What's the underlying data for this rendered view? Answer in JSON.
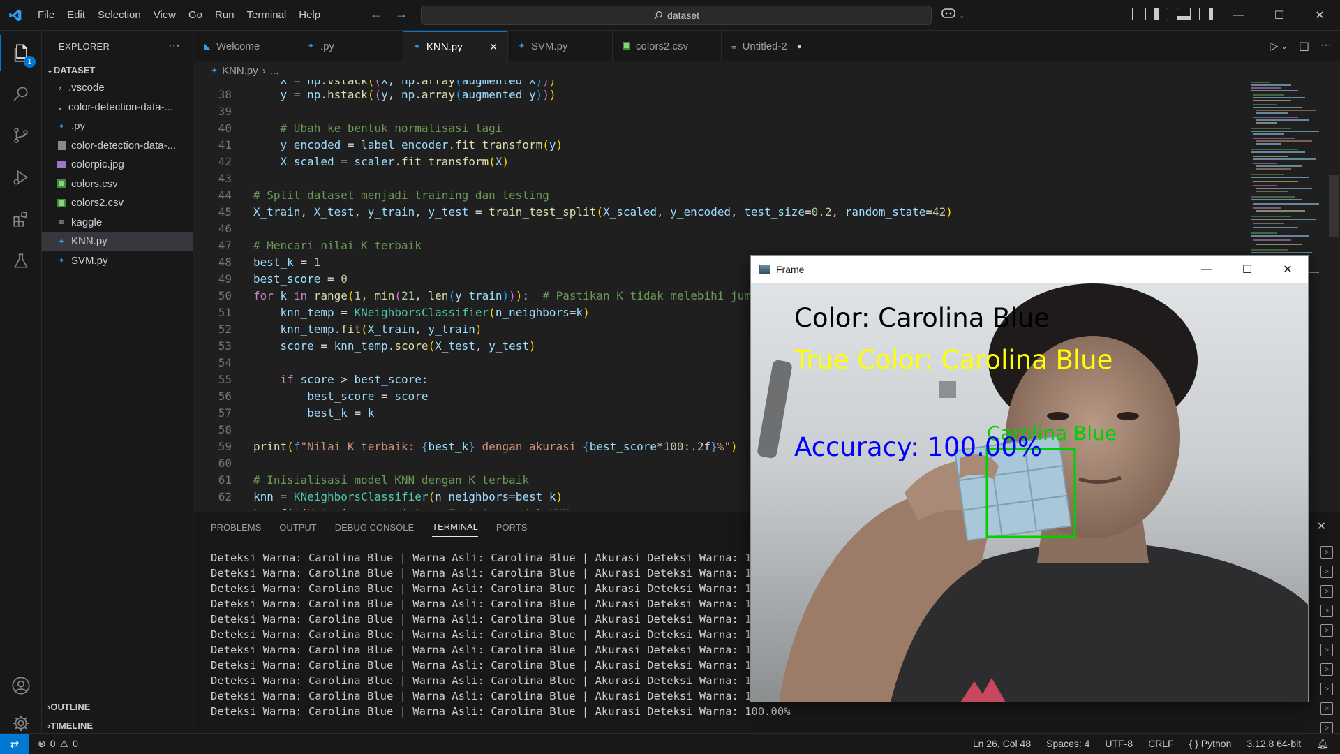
{
  "menu": [
    "File",
    "Edit",
    "Selection",
    "View",
    "Go",
    "Run",
    "Terminal",
    "Help"
  ],
  "search": {
    "value": "dataset"
  },
  "window_controls": {
    "minimize": "—",
    "maximize": "☐",
    "close": "✕"
  },
  "activity": {
    "explorer_badge": "1"
  },
  "sidebar": {
    "title": "EXPLORER",
    "more": "···",
    "folder": "DATASET",
    "items": [
      {
        "label": ".vscode",
        "type": "folder"
      },
      {
        "label": "color-detection-data-...",
        "type": "folder-open"
      },
      {
        "label": ".py",
        "type": "python"
      },
      {
        "label": "color-detection-data-...",
        "type": "file"
      },
      {
        "label": "colorpic.jpg",
        "type": "image"
      },
      {
        "label": "colors.csv",
        "type": "csv"
      },
      {
        "label": "colors2.csv",
        "type": "csv"
      },
      {
        "label": "kaggle",
        "type": "text"
      },
      {
        "label": "KNN.py",
        "type": "python",
        "selected": true
      },
      {
        "label": "SVM.py",
        "type": "python"
      }
    ],
    "outline": "OUTLINE",
    "timeline": "TIMELINE"
  },
  "tabs": [
    {
      "label": "Welcome",
      "icon": "vscode"
    },
    {
      "label": ".py",
      "icon": "python"
    },
    {
      "label": "KNN.py",
      "icon": "python",
      "active": true,
      "close": "✕"
    },
    {
      "label": "SVM.py",
      "icon": "python"
    },
    {
      "label": "colors2.csv",
      "icon": "csv"
    },
    {
      "label": "Untitled-2",
      "icon": "text",
      "dirty": "●"
    }
  ],
  "breadcrumb": {
    "file": "KNN.py",
    "rest": "..."
  },
  "editor": {
    "line_numbers": [
      "38",
      "39",
      "40",
      "41",
      "42",
      "43",
      "44",
      "45",
      "46",
      "47",
      "48",
      "49",
      "50",
      "51",
      "52",
      "53",
      "54",
      "55",
      "56",
      "57",
      "58",
      "59",
      "60",
      "61",
      "62"
    ]
  },
  "panel": {
    "tabs": [
      "PROBLEMS",
      "OUTPUT",
      "DEBUG CONSOLE",
      "TERMINAL",
      "PORTS"
    ],
    "active_tab": "TERMINAL",
    "terminal_lines": [
      "Deteksi Warna: Carolina Blue | Warna Asli: Carolina Blue | Akurasi Deteksi Warna: 100.",
      "Deteksi Warna: Carolina Blue | Warna Asli: Carolina Blue | Akurasi Deteksi Warna: 100.",
      "Deteksi Warna: Carolina Blue | Warna Asli: Carolina Blue | Akurasi Deteksi Warna: 100.",
      "Deteksi Warna: Carolina Blue | Warna Asli: Carolina Blue | Akurasi Deteksi Warna: 100.",
      "Deteksi Warna: Carolina Blue | Warna Asli: Carolina Blue | Akurasi Deteksi Warna: 100.",
      "Deteksi Warna: Carolina Blue | Warna Asli: Carolina Blue | Akurasi Deteksi Warna: 100.",
      "Deteksi Warna: Carolina Blue | Warna Asli: Carolina Blue | Akurasi Deteksi Warna: 100.",
      "Deteksi Warna: Carolina Blue | Warna Asli: Carolina Blue | Akurasi Deteksi Warna: 100.",
      "Deteksi Warna: Carolina Blue | Warna Asli: Carolina Blue | Akurasi Deteksi Warna: 100.",
      "Deteksi Warna: Carolina Blue | Warna Asli: Carolina Blue | Akurasi Deteksi Warna: 100.",
      "Deteksi Warna: Carolina Blue | Warna Asli: Carolina Blue | Akurasi Deteksi Warna: 100.00%"
    ]
  },
  "frame_window": {
    "title": "Frame",
    "color_label": "Color: Carolina Blue",
    "true_color_label": "True Color: Carolina Blue",
    "accuracy_label": "Accuracy: 100.00%",
    "box_label": "Carolina Blue"
  },
  "statusbar": {
    "errors": "0",
    "warnings": "0",
    "position": "Ln 26, Col 48",
    "spaces": "Spaces: 4",
    "encoding": "UTF-8",
    "eol": "CRLF",
    "language": "Python",
    "interpreter": "3.12.8 64-bit"
  },
  "colors": {
    "accent": "#0078d4",
    "overlay_black": "#000000",
    "overlay_yellow": "#ffff00",
    "overlay_blue": "#0000ff",
    "overlay_green": "#00d000"
  }
}
